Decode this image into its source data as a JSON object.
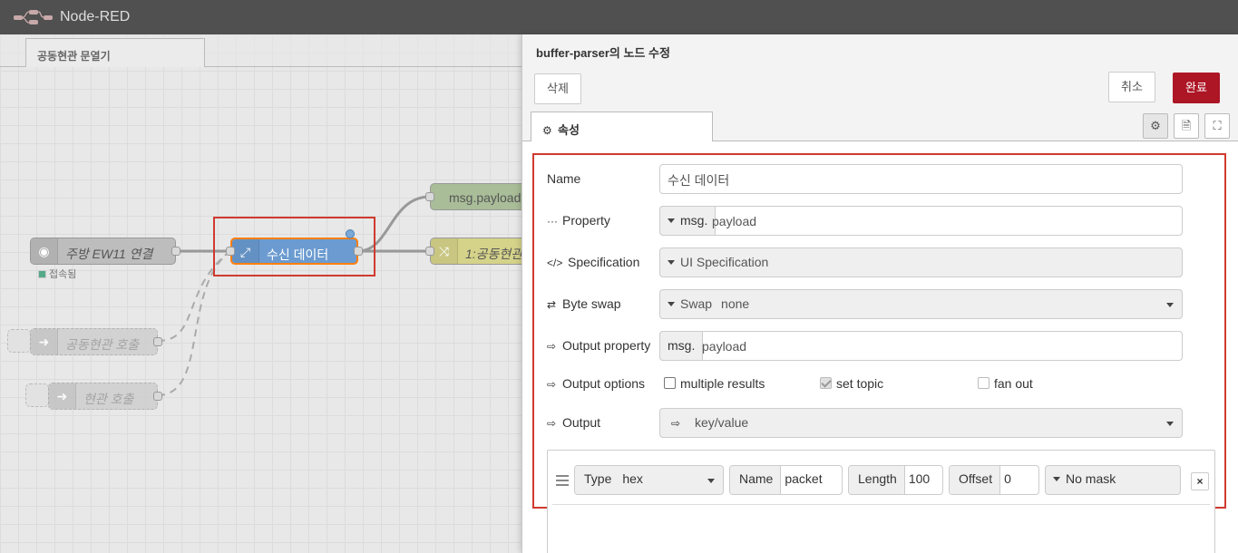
{
  "header": {
    "app_title": "Node-RED"
  },
  "workspace": {
    "flow_tab": "공동현관 문열기",
    "nodes": {
      "kitchen_ew11": "주방 EW11 연결",
      "kitchen_status": "접속됨",
      "receive_data": "수신 데이터",
      "msg_payload": "msg.payload",
      "door_switch": "1:공동현관",
      "common_call": "공동현관 호출",
      "entrance_call": "현관 호출"
    }
  },
  "tray": {
    "title": "buffer-parser의 노드 수정",
    "delete_label": "삭제",
    "cancel_label": "취소",
    "done_label": "완료",
    "tab_properties": "속성",
    "form": {
      "name_label": "Name",
      "name_value": "수신 데이터",
      "property_label": "Property",
      "property_prefix": "msg.",
      "property_value": "payload",
      "spec_label": "Specification",
      "spec_value": "UI Specification",
      "byteswap_label": "Byte swap",
      "byteswap_prefix": "Swap",
      "byteswap_value": "none",
      "outprop_label": "Output property",
      "outprop_prefix": "msg.",
      "outprop_value": "payload",
      "outopts_label": "Output options",
      "opt_multiple": "multiple results",
      "opt_settopic": "set topic",
      "opt_fanout": "fan out",
      "output_label": "Output",
      "output_value": "key/value"
    },
    "spec_row": {
      "type_label": "Type",
      "type_value": "hex",
      "name_label": "Name",
      "name_value": "packet",
      "length_label": "Length",
      "length_value": "100",
      "offset_label": "Offset",
      "offset_value": "0",
      "mask_value": "No mask",
      "remove_glyph": "×"
    }
  }
}
